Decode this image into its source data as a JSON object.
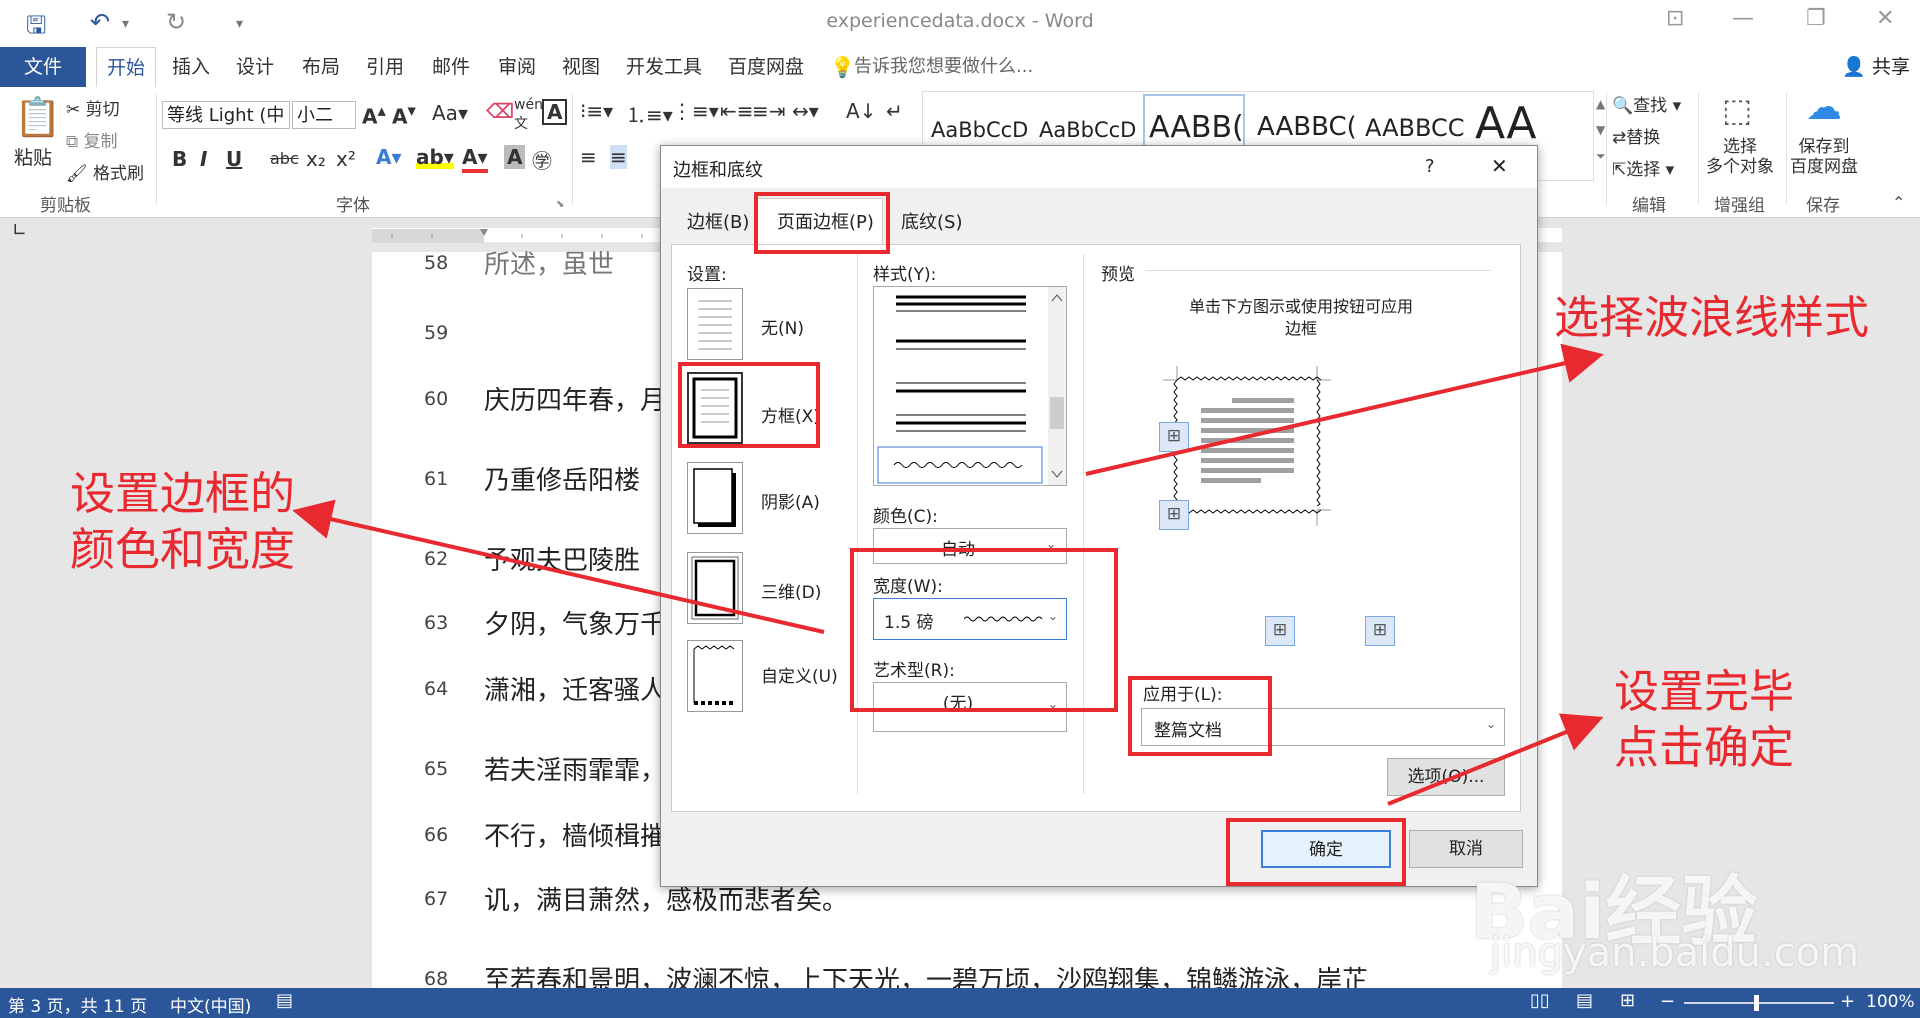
{
  "app": {
    "title": "experiencedata.docx - Word"
  },
  "tabs": {
    "file": "文件",
    "items": [
      "开始",
      "插入",
      "设计",
      "布局",
      "引用",
      "邮件",
      "审阅",
      "视图",
      "开发工具",
      "百度网盘"
    ],
    "tell": "告诉我您想要做什么...",
    "share": "共享"
  },
  "ribbon": {
    "paste": "粘贴",
    "cut": "剪切",
    "copy": "复制",
    "format_painter": "格式刷",
    "clipboard_group": "剪贴板",
    "font_name": "等线 Light (中",
    "font_size": "小二",
    "font_group": "字体",
    "bold": "B",
    "italic": "I",
    "underline": "U",
    "style_samples": [
      "AaBbCcD",
      "AaBbCcD",
      "AABB(",
      "AABBC(",
      "AABBCC",
      "AA"
    ],
    "find": "查找",
    "replace": "替换",
    "select": "选择",
    "edit_group": "编辑",
    "select_multi": "选择\n多个对象",
    "enhance_group": "增强组",
    "save_baidu": "保存到\n百度网盘",
    "save_group": "保存"
  },
  "document": {
    "lines": [
      {
        "num": "58",
        "text": "所述，虽世"
      },
      {
        "num": "59",
        "text": ""
      },
      {
        "num": "60",
        "text": "庆历四年春，月"
      },
      {
        "num": "61",
        "text": "乃重修岳阳楼"
      },
      {
        "num": "62",
        "text": "予观夫巴陵胜"
      },
      {
        "num": "63",
        "text": "夕阴，气象万千"
      },
      {
        "num": "64",
        "text": "潇湘，迁客骚人"
      },
      {
        "num": "65",
        "text": "若夫淫雨霏霏，"
      },
      {
        "num": "66",
        "text": "不行，樯倾楫摧"
      },
      {
        "num": "67",
        "text": "讥，满目萧然，感极而悲者矣。"
      },
      {
        "num": "68",
        "text": "至若春和景明，波澜不惊，上下天光，一碧万顷，沙鸥翔集，锦鳞游泳，岸芷"
      }
    ]
  },
  "status": {
    "page": "第 3 页，共 11 页",
    "lang": "中文(中国)",
    "zoom": "100%"
  },
  "dialog": {
    "title": "边框和底纹",
    "help": "?",
    "close": "✕",
    "tabs": [
      "边框(B)",
      "页面边框(P)",
      "底纹(S)"
    ],
    "settings_label": "设置:",
    "settings": [
      "无(N)",
      "方框(X)",
      "阴影(A)",
      "三维(D)",
      "自定义(U)"
    ],
    "style_label": "样式(Y):",
    "color_label": "颜色(C):",
    "color_value": "自动",
    "width_label": "宽度(W):",
    "width_value": "1.5 磅",
    "art_label": "艺术型(R):",
    "art_value": "(无)",
    "preview_label": "预览",
    "preview_hint": "单击下方图示或使用按钮可应用\n边框",
    "apply_label": "应用于(L):",
    "apply_value": "整篇文档",
    "options": "选项(O)...",
    "ok": "确定",
    "cancel": "取消"
  },
  "annotations": {
    "wave": "选择波浪线样式",
    "color_width": "设置边框的\n颜色和宽度",
    "done": "设置完毕\n点击确定"
  },
  "watermark": {
    "brand": "Bai经验",
    "url": "jingyan.baidu.com"
  },
  "colors": {
    "accent": "#2b579a",
    "annotation": "#e8292f"
  }
}
